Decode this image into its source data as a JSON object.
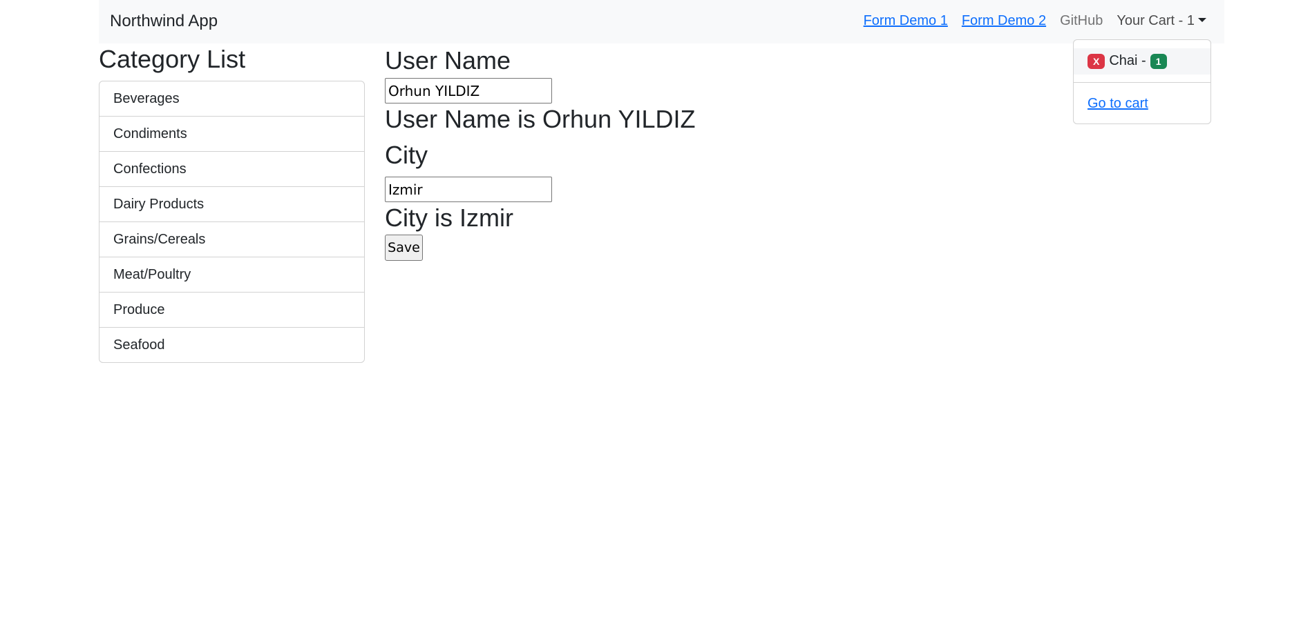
{
  "navbar": {
    "brand": "Northwind App",
    "links": {
      "form_demo_1": "Form Demo 1",
      "form_demo_2": "Form Demo 2",
      "github": "GitHub",
      "cart": "Your Cart - 1"
    }
  },
  "cart_dropdown": {
    "remove_badge": "X",
    "item_name": "Chai -",
    "item_quantity": "1",
    "go_to_cart": "Go to cart"
  },
  "categories": {
    "title": "Category List",
    "items": [
      "Beverages",
      "Condiments",
      "Confections",
      "Dairy Products",
      "Grains/Cereals",
      "Meat/Poultry",
      "Produce",
      "Seafood"
    ]
  },
  "form": {
    "user_name_label": "User Name",
    "user_name_value": "Orhun YILDIZ",
    "user_name_echo": "User Name is Orhun YILDIZ",
    "city_label": "City",
    "city_value": "Izmir",
    "city_echo": "City is Izmir",
    "save_label": "Save"
  },
  "colors": {
    "navbar_bg": "#f8f9fa",
    "link": "#0d6efd",
    "badge_danger": "#dc3545",
    "badge_success": "#198754"
  }
}
